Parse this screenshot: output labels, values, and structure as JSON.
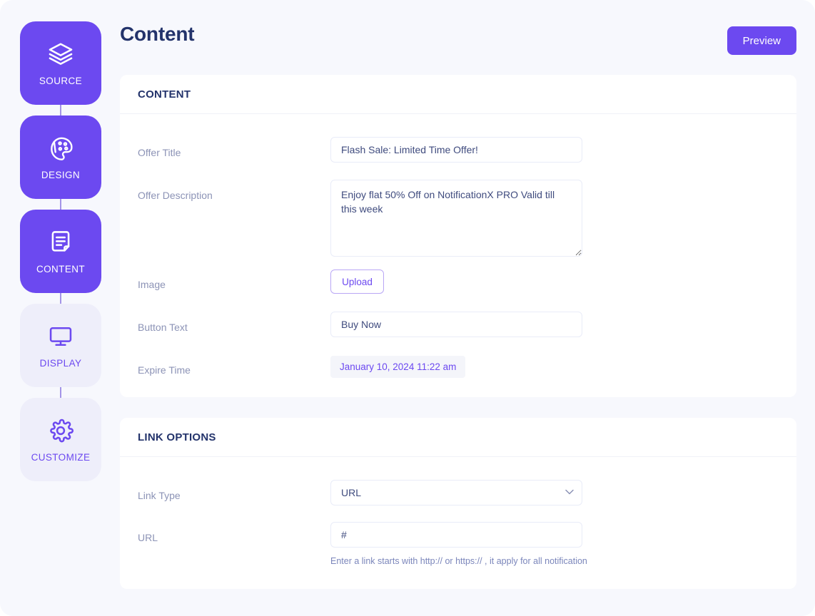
{
  "theme": {
    "accent": "#6c49f0",
    "accent_soft": "#eeeefa",
    "page_bg": "#f7f8fd",
    "heading": "#23336b",
    "label": "#8c93b6",
    "input_text": "#3f4b7e",
    "border": "#e9ecf8"
  },
  "stepper": {
    "items": [
      {
        "label": "SOURCE",
        "icon": "layers-icon",
        "active": true
      },
      {
        "label": "DESIGN",
        "icon": "palette-icon",
        "active": true
      },
      {
        "label": "CONTENT",
        "icon": "document-icon",
        "active": true
      },
      {
        "label": "DISPLAY",
        "icon": "monitor-icon",
        "active": false
      },
      {
        "label": "CUSTOMIZE",
        "icon": "gear-icon",
        "active": false
      }
    ]
  },
  "header": {
    "title": "Content",
    "preview_label": "Preview"
  },
  "content_card": {
    "section_title": "CONTENT",
    "fields": {
      "offer_title": {
        "label": "Offer Title",
        "value": "Flash Sale: Limited Time Offer!",
        "placeholder": "Offer Title"
      },
      "offer_description": {
        "label": "Offer Description",
        "value": "Enjoy flat 50% Off on NotificationX PRO Valid till this week",
        "placeholder": "Offer Description"
      },
      "image": {
        "label": "Image",
        "upload_label": "Upload"
      },
      "button_text": {
        "label": "Button Text",
        "value": "Buy Now",
        "placeholder": "Button Text"
      },
      "expire_time": {
        "label": "Expire Time",
        "value": "January 10, 2024 11:22 am"
      }
    }
  },
  "link_card": {
    "section_title": "LINK OPTIONS",
    "fields": {
      "link_type": {
        "label": "Link Type",
        "value": "URL",
        "options": [
          "URL"
        ]
      },
      "url": {
        "label": "URL",
        "value": "#",
        "placeholder": "#",
        "helper": "Enter a link starts with http:// or https:// , it apply for all notification"
      }
    }
  }
}
